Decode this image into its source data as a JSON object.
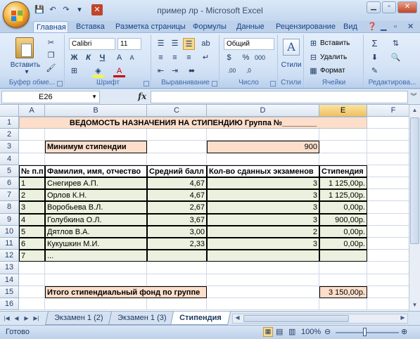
{
  "window": {
    "title": "пример лр - Microsoft Excel"
  },
  "quick_access": [
    "save-icon",
    "undo-icon",
    "redo-icon",
    "customize-icon"
  ],
  "ribbon_tabs": [
    "Главная",
    "Вставка",
    "Разметка страницы",
    "Формулы",
    "Данные",
    "Рецензирование",
    "Вид"
  ],
  "active_tab": "Главная",
  "ribbon": {
    "clipboard": {
      "label": "Буфер обме...",
      "paste": "Вставить"
    },
    "font": {
      "label": "Шрифт",
      "font_name": "Calibri",
      "font_size": "11",
      "bold": "Ж",
      "italic": "К",
      "underline": "Ч"
    },
    "alignment": {
      "label": "Выравнивание"
    },
    "number": {
      "label": "Число",
      "format": "Общий"
    },
    "styles": {
      "label": "Стили"
    },
    "cells": {
      "label": "Ячейки",
      "insert": "Вставить",
      "delete": "Удалить",
      "format": "Формат"
    },
    "editing": {
      "label": "Редактирова..."
    }
  },
  "formula_bar": {
    "name_box": "E26",
    "fx": "fx",
    "formula": ""
  },
  "columns": [
    "A",
    "B",
    "C",
    "D",
    "E",
    "F"
  ],
  "rows": [
    "1",
    "2",
    "3",
    "4",
    "5",
    "6",
    "7",
    "8",
    "9",
    "10",
    "11",
    "12",
    "13",
    "14",
    "15",
    "16"
  ],
  "sheet": {
    "title": "ВЕДОМОСТЬ НАЗНАЧЕНИЯ НА СТИПЕНДИЮ Группа №________",
    "min_label": "Минимум стипендии",
    "min_value": "900",
    "headers": [
      "№ п.п",
      "Фамилия, имя, отчество",
      "Средний балл",
      "Кол-во сданных экзаменов",
      "Стипендия"
    ],
    "students": [
      {
        "n": "1",
        "name": "Снегирев А.П.",
        "avg": "4,67",
        "exams": "3",
        "grant": "1 125,00р."
      },
      {
        "n": "2",
        "name": "Орлов К.Н.",
        "avg": "4,67",
        "exams": "3",
        "grant": "1 125,00р."
      },
      {
        "n": "3",
        "name": "Воробьева В.Л.",
        "avg": "2,67",
        "exams": "3",
        "grant": "0,00р."
      },
      {
        "n": "4",
        "name": "Голубкина О.Л.",
        "avg": "3,67",
        "exams": "3",
        "grant": "900,00р."
      },
      {
        "n": "5",
        "name": "Дятлов В.А.",
        "avg": "3,00",
        "exams": "2",
        "grant": "0,00р."
      },
      {
        "n": "6",
        "name": "Кукушкин М.И.",
        "avg": "2,33",
        "exams": "3",
        "grant": "0,00р."
      },
      {
        "n": "7",
        "name": "...",
        "avg": "",
        "exams": "",
        "grant": ""
      }
    ],
    "total_label": "Итого стипендиальный фонд по группе",
    "total_value": "3 150,00р."
  },
  "sheet_tabs": [
    "Экзамен 1 (2)",
    "Экзамен 1 (3)",
    "Стипендия"
  ],
  "active_sheet": "Стипендия",
  "status": {
    "ready": "Готово",
    "zoom": "100%"
  },
  "colors": {
    "peach": "#fcdecb",
    "green": "#ebf1de",
    "selected_header": "#f1c15f"
  }
}
